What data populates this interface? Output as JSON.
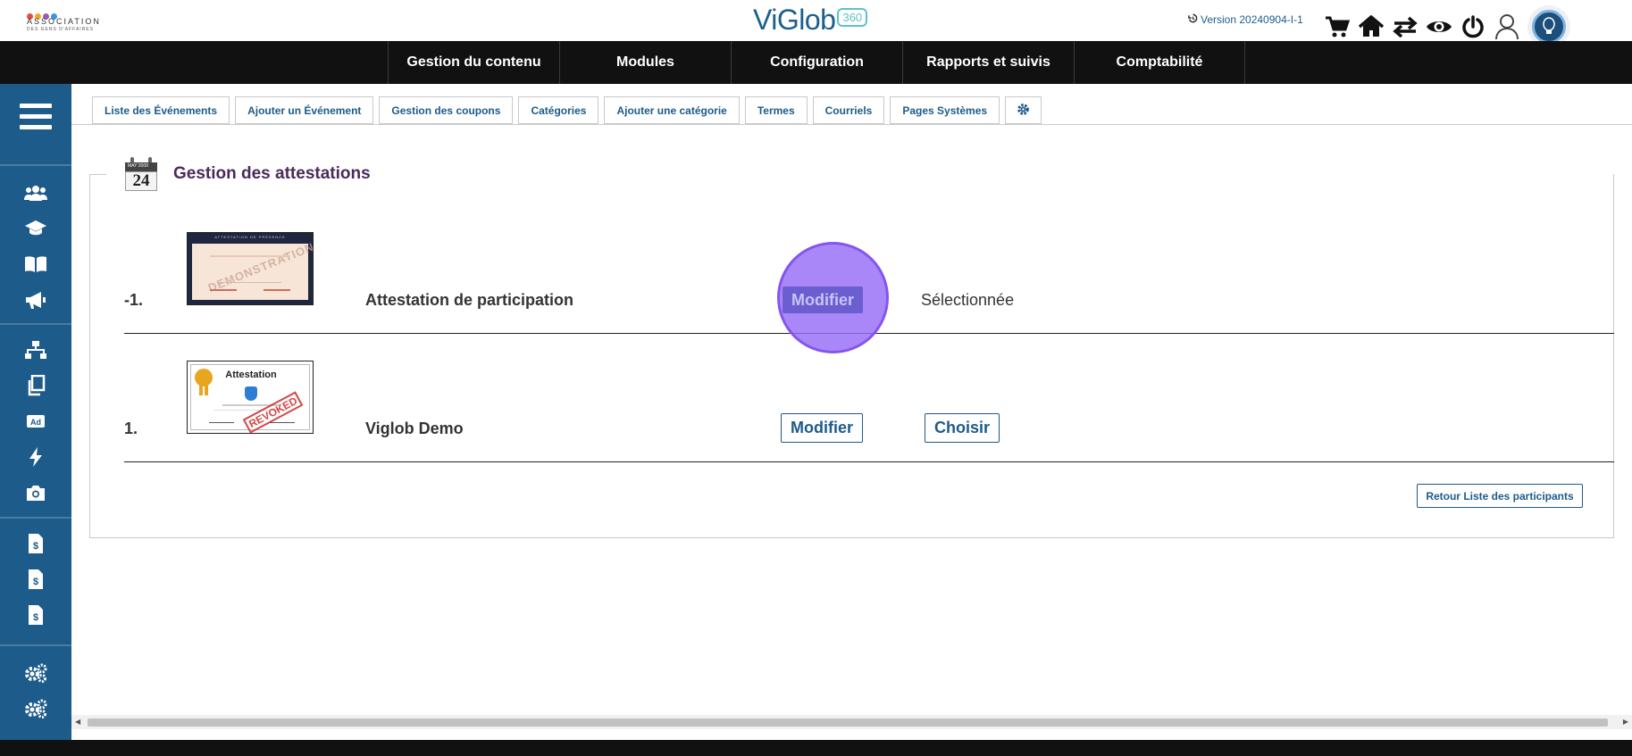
{
  "org": {
    "name": "ASSOCIATION",
    "subtitle": "DES GENS D'AFFAIRES",
    "dot_colors": [
      "#e74c3c",
      "#f5a623",
      "#9b59b6",
      "#3498db"
    ]
  },
  "brand": {
    "name": "ViGlob",
    "badge": "360"
  },
  "header": {
    "version": "Version 20240904-I-1",
    "icons": [
      "cart-icon",
      "home-icon",
      "swap-icon",
      "eye-icon",
      "power-icon",
      "user-icon"
    ]
  },
  "nav": {
    "items": [
      {
        "label": "Gestion du contenu"
      },
      {
        "label": "Modules"
      },
      {
        "label": "Configuration"
      },
      {
        "label": "Rapports et suivis"
      },
      {
        "label": "Comptabilité"
      }
    ]
  },
  "sidebar": {
    "icons": [
      "users-icon",
      "graduation-cap-icon",
      "book-icon",
      "megaphone-icon",
      "sitemap-icon",
      "copy-icon",
      "ad-icon",
      "bolt-icon",
      "camera-icon",
      "invoice-icon",
      "invoice-icon",
      "invoice-icon",
      "cogs-icon",
      "cogs-icon"
    ]
  },
  "subtabs": [
    {
      "label": "Liste des Événements"
    },
    {
      "label": "Ajouter un Événement"
    },
    {
      "label": "Gestion des coupons"
    },
    {
      "label": "Catégories"
    },
    {
      "label": "Ajouter une catégorie"
    },
    {
      "label": "Termes"
    },
    {
      "label": "Courriels"
    },
    {
      "label": "Pages Systèmes"
    }
  ],
  "panel": {
    "title": "Gestion des attestations",
    "calendar": {
      "day": "24",
      "month": "MAY 2009"
    }
  },
  "rows": [
    {
      "number": "-1.",
      "name": "Attestation de participation",
      "edit_label": "Modifier",
      "status": "Sélectionnée",
      "thumb_title": "ATTESTATION DE PRÉSENCE",
      "thumb_watermark": "DEMONSTRATION"
    },
    {
      "number": "1.",
      "name": "Viglob Demo",
      "edit_label": "Modifier",
      "choose_label": "Choisir",
      "thumb_title": "Attestation",
      "thumb_stamp": "REVOKED"
    }
  ],
  "actions": {
    "return_label": "Retour Liste des participants"
  },
  "colors": {
    "primary": "#1d5b8a",
    "nav_bg": "#111111",
    "title": "#4b2a5a",
    "highlight": "#976cf6"
  }
}
